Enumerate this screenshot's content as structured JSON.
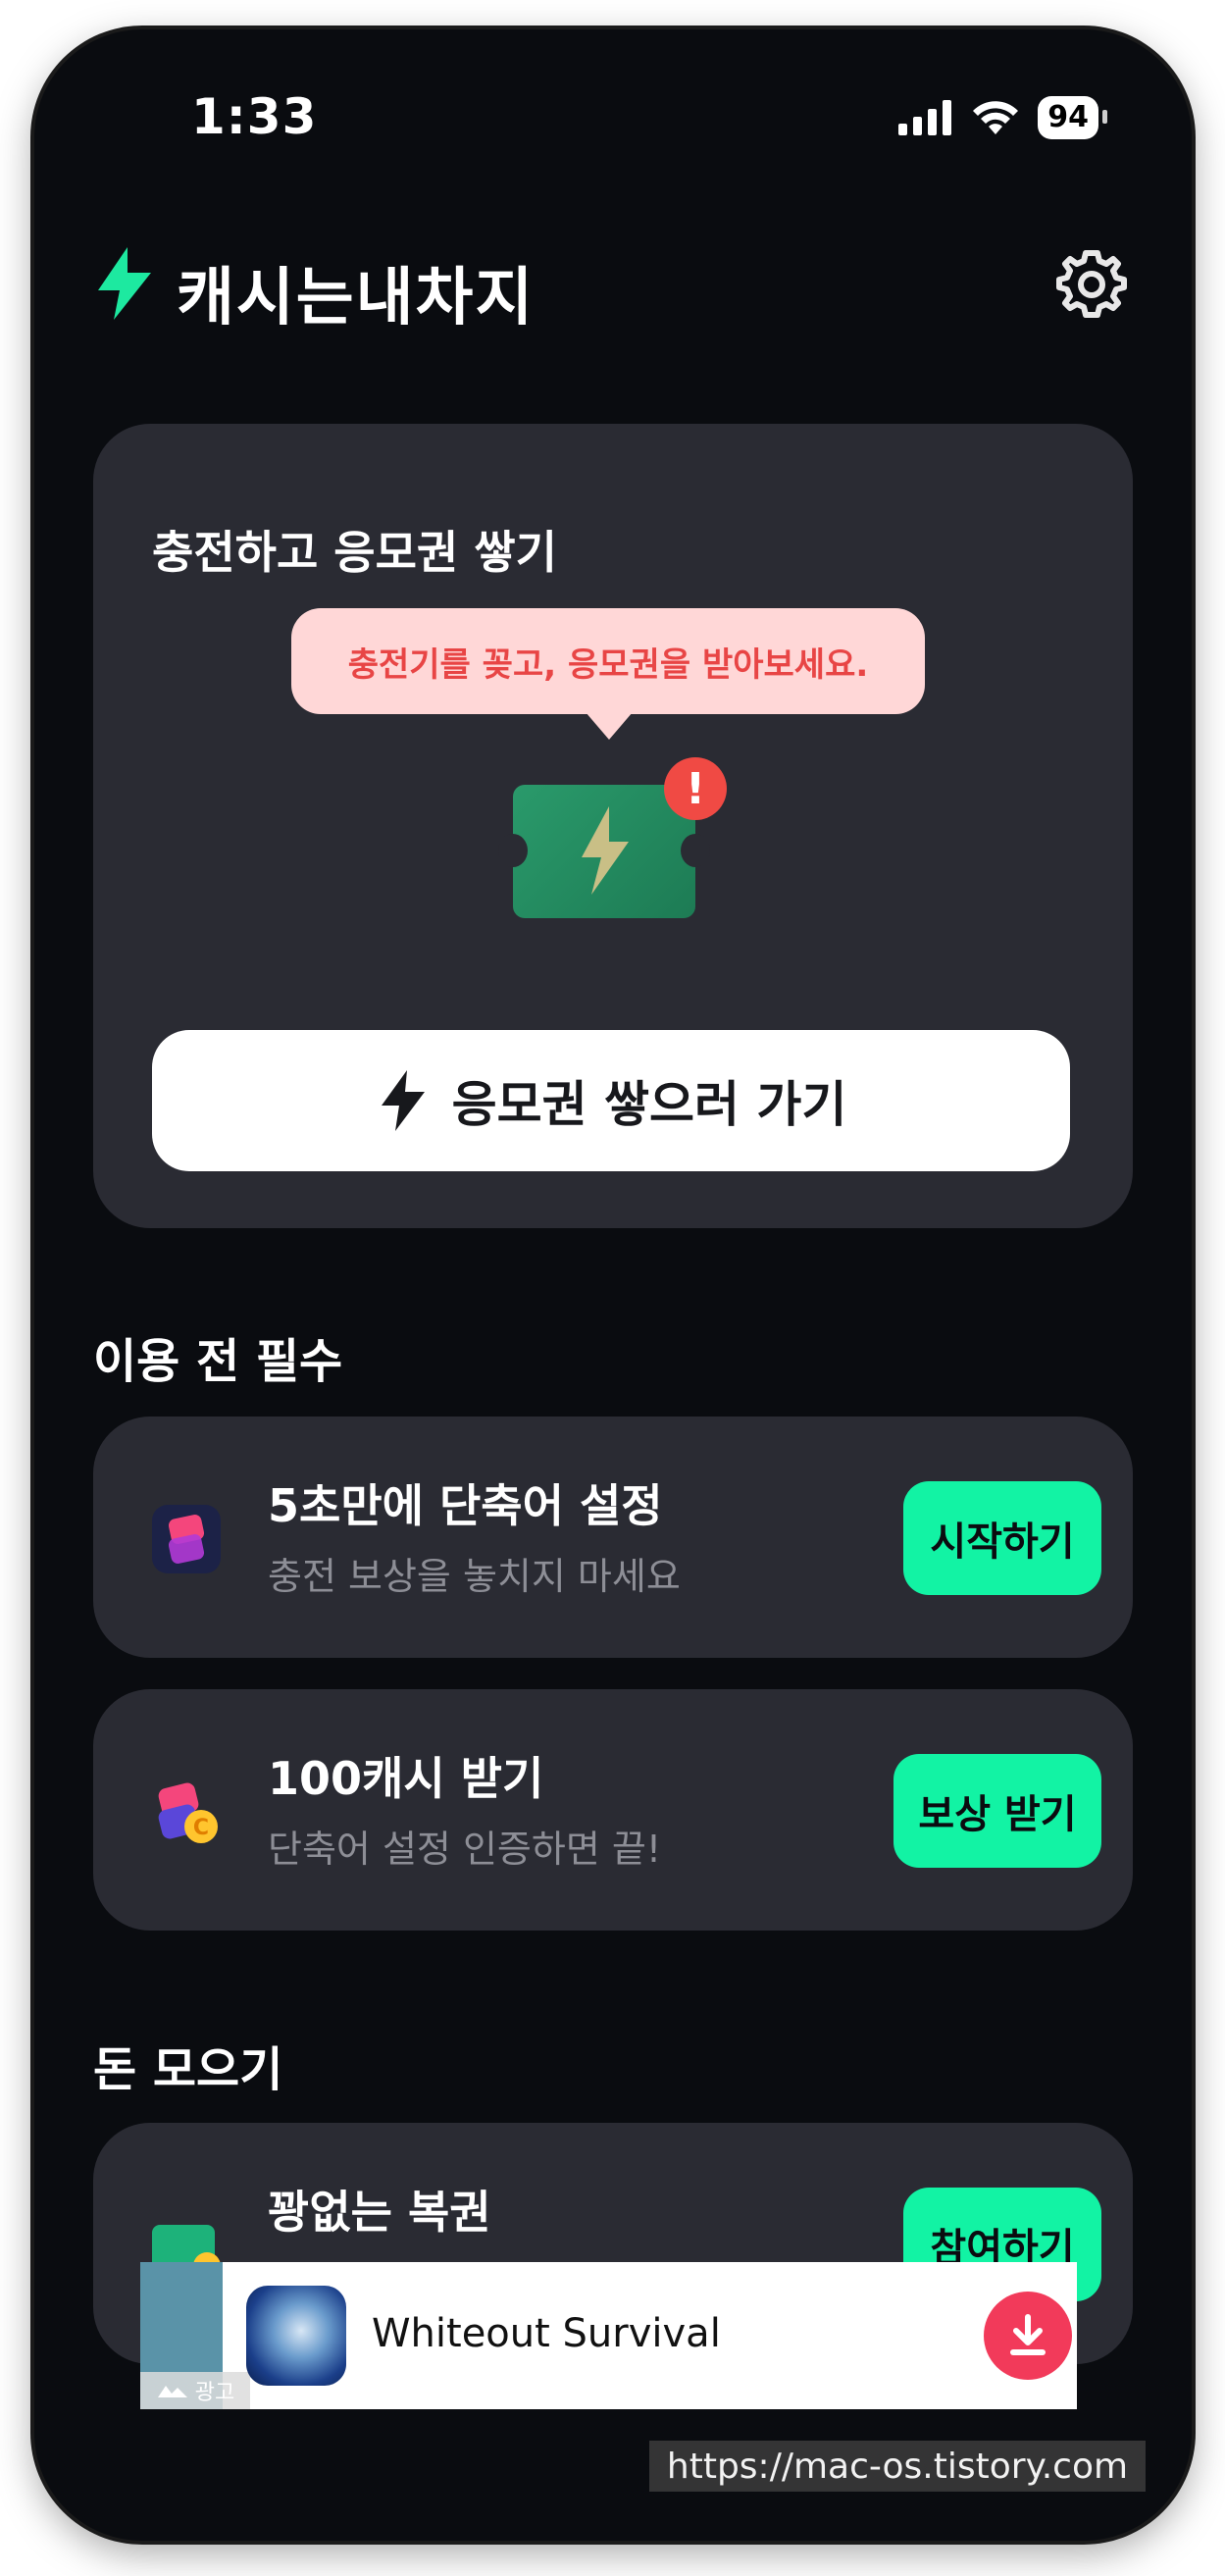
{
  "status_bar": {
    "time": "1:33",
    "battery": "94"
  },
  "header": {
    "title": "캐시는내차지",
    "accent_color": "#1de9a0"
  },
  "charge_card": {
    "title": "충전하고 응모권 쌓기",
    "tooltip": "충전기를 꽂고, 응모권을 받아보세요.",
    "badge": "!",
    "button_label": "응모권 쌓으러 가기"
  },
  "sections": {
    "required": {
      "title": "이용 전 필수"
    },
    "earn": {
      "title": "돈 모으기"
    }
  },
  "tasks": [
    {
      "title": "5초만에 단축어 설정",
      "subtitle": "충전 보상을 놓치지 마세요",
      "button": "시작하기",
      "icon": "shortcuts-icon"
    },
    {
      "title": "100캐시 받기",
      "subtitle": "단축어 설정 인증하면 끝!",
      "button": "보상 받기",
      "icon": "cash-shortcuts-icon"
    },
    {
      "title": "꽝없는 복권",
      "subtitle": "",
      "button": "참여하기",
      "icon": "lottery-ticket-icon"
    }
  ],
  "ad": {
    "app_name": "Whiteout Survival",
    "tag": "광고"
  },
  "watermark": "https://mac-os.tistory.com"
}
